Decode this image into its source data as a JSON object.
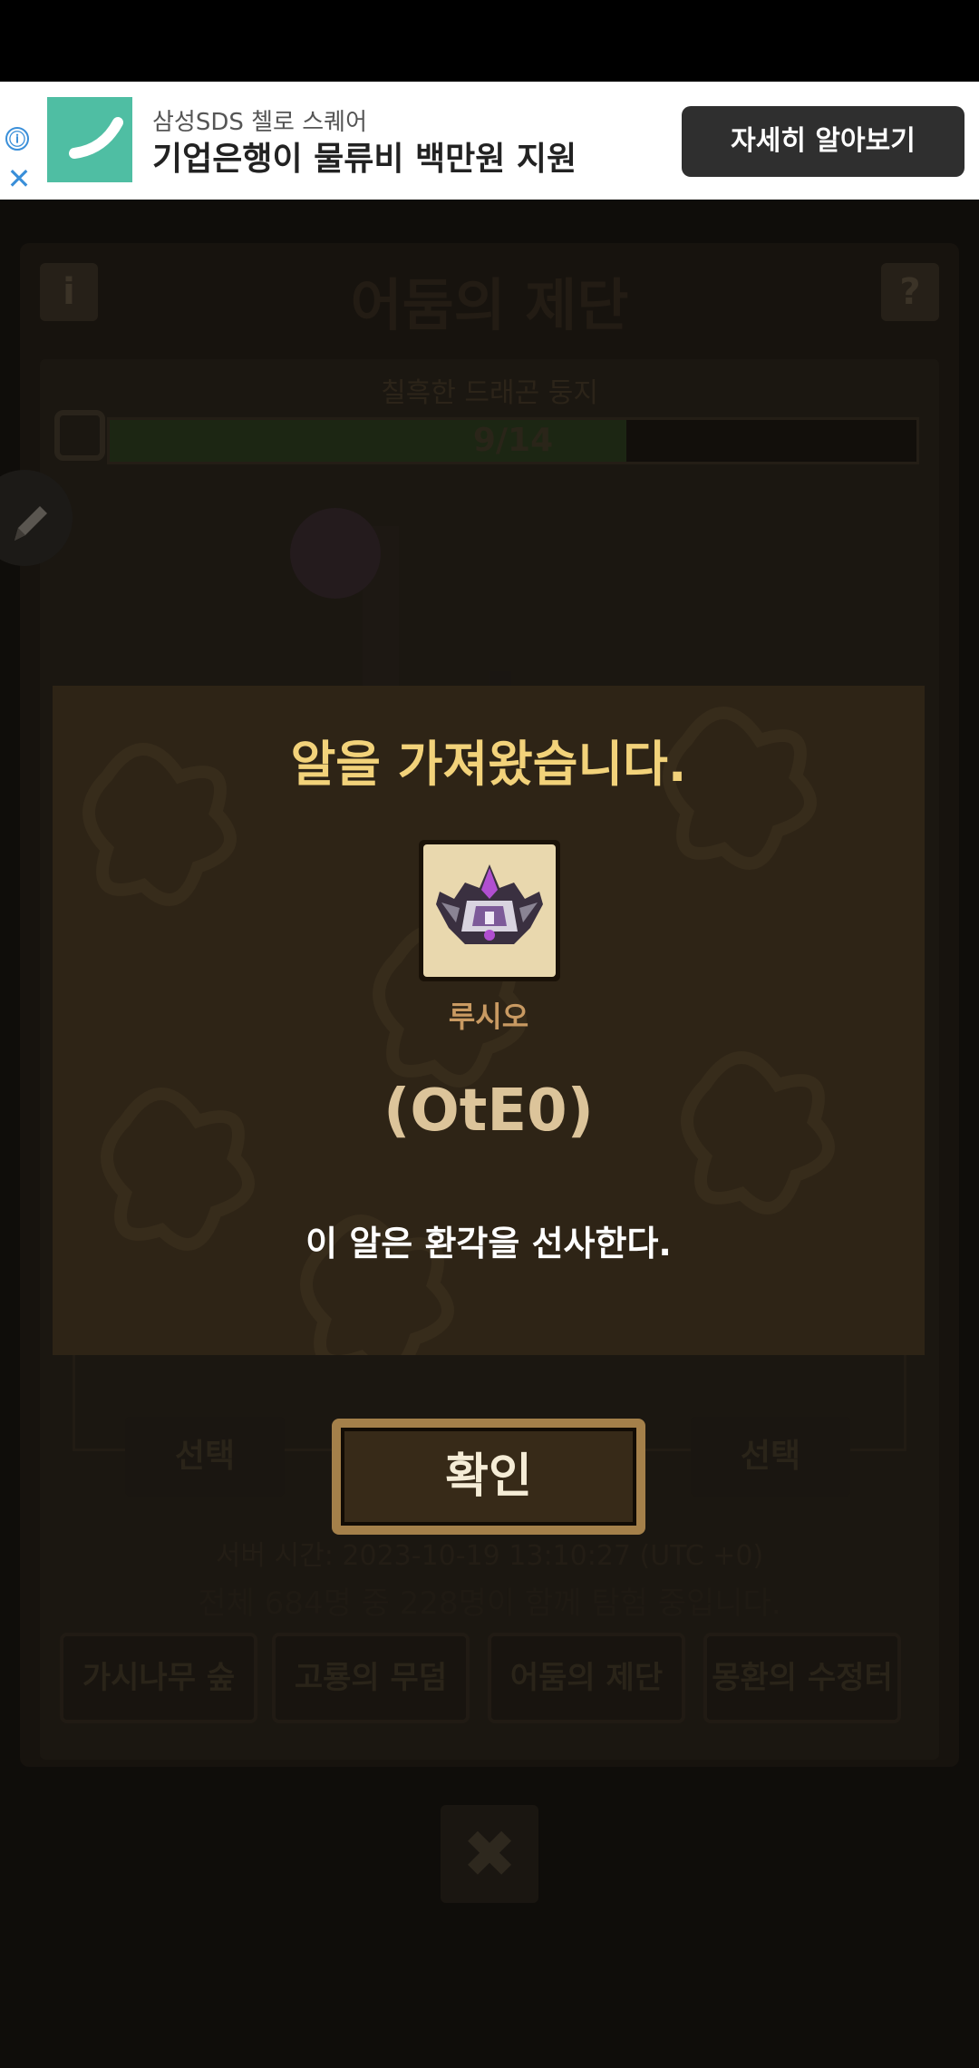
{
  "ad": {
    "sponsor": "삼성SDS 첼로 스퀘어",
    "headline": "기업은행이 물류비 백만원 지원",
    "cta_label": "자세히 알아보기",
    "info_icon": "ⓘ",
    "close_icon": "✕"
  },
  "game": {
    "info_button": "i",
    "title": "어둠의 제단",
    "help_button": "?",
    "subtitle": "칠흑한 드래곤 둥지",
    "progress_text": "9/14",
    "progress_value": 0.64,
    "select_labels": [
      "선택",
      "선택"
    ],
    "server_time": "서버 시간: 2023-10-19 13:10:27 (UTC +0)",
    "participants": "전체 684명 중 228명이 함께 탐험 중입니다.",
    "tabs": [
      "가시나무 숲",
      "고룡의 무덤",
      "어둠의 제단",
      "몽환의 수정터"
    ],
    "close_icon": "✖"
  },
  "modal": {
    "title": "알을 가져왔습니다.",
    "item_name": "루시오",
    "item_code": "(OtE0)",
    "description": "이 알은 환각을 선사한다.",
    "confirm_label": "확인"
  },
  "colors": {
    "accent_gold": "#f2d27a",
    "modal_bg": "#2e2416",
    "ad_cta": "#2f2f2f",
    "ad_logo": "#4fbea3"
  },
  "icons": [
    "info-icon",
    "close-icon",
    "gear-icon",
    "pencil-icon",
    "egg-item-icon"
  ]
}
